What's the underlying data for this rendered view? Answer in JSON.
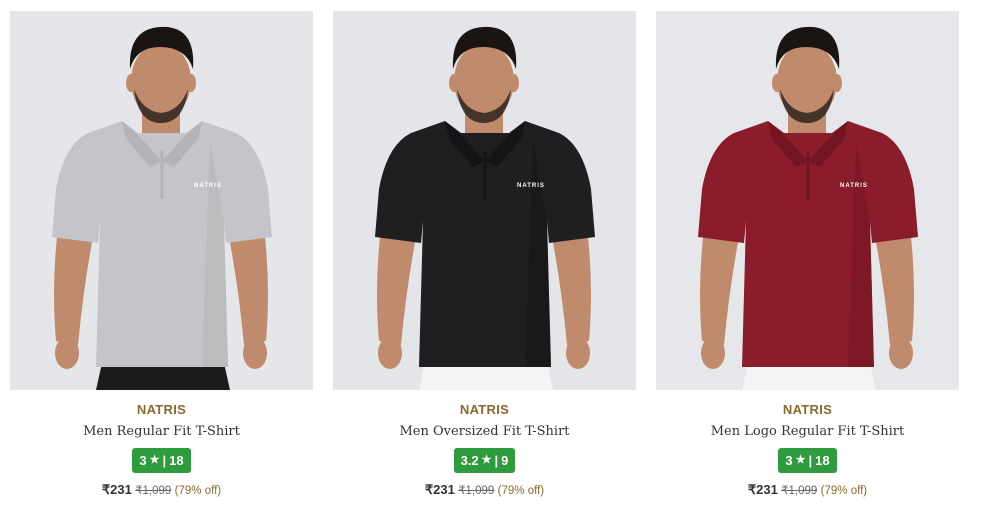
{
  "products": [
    {
      "image_alt": "Man wearing a light grey half-zip polo T-shirt",
      "shirt_color": "#c4c5c8",
      "shirt_shade": "#b3b4b7",
      "pants_color": "#1c1c1c",
      "bg_color": "#e5e6ea",
      "chest_print": "NATRIS",
      "brand": "NATRIS",
      "title": "Men Regular Fit T-Shirt",
      "rating": "3",
      "star": "★",
      "reviews": "18",
      "price": "₹231",
      "mrp": "₹1,099",
      "discount": "(79% off)"
    },
    {
      "image_alt": "Man wearing a black polo T-shirt",
      "shirt_color": "#1f1f21",
      "shirt_shade": "#141416",
      "pants_color": "#f4f4f4",
      "bg_color": "#e4e5e9",
      "chest_print": "NATRIS",
      "brand": "NATRIS",
      "title": "Men Oversized Fit T-Shirt",
      "rating": "3.2",
      "star": "★",
      "reviews": "9",
      "price": "₹231",
      "mrp": "₹1,099",
      "discount": "(79% off)"
    },
    {
      "image_alt": "Man wearing a maroon half-zip polo T-shirt",
      "shirt_color": "#8a1c2b",
      "shirt_shade": "#741522",
      "pants_color": "#f4f4f4",
      "bg_color": "#e6e7eb",
      "chest_print": "NATRIS",
      "brand": "NATRIS",
      "title": "Men Logo Regular Fit T-Shirt",
      "rating": "3",
      "star": "★",
      "reviews": "18",
      "price": "₹231",
      "mrp": "₹1,099",
      "discount": "(79% off)"
    }
  ],
  "colors": {
    "brand_text": "#8a6a2b",
    "rating_badge": "#2e9b3c",
    "skin": "#c08a6c",
    "hair": "#1a1512"
  }
}
